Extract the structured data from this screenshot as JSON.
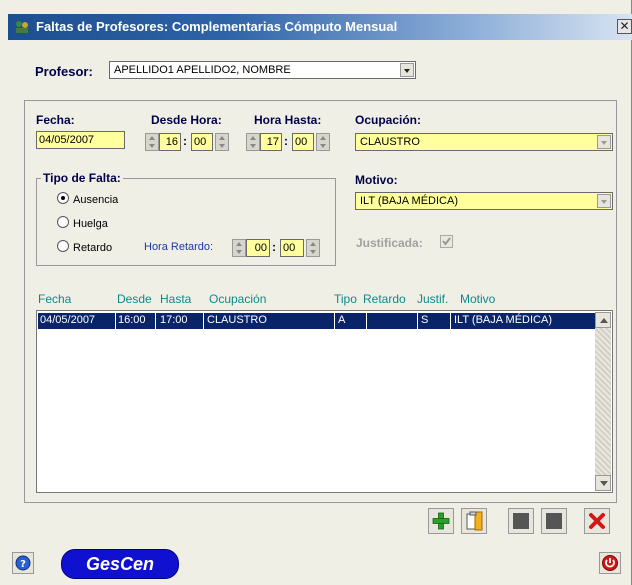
{
  "window": {
    "title": "Faltas de Profesores: Complementarias Cómputo Mensual",
    "close_icon": "close-icon"
  },
  "profesor": {
    "label": "Profesor:",
    "value": "APELLIDO1 APELLIDO2, NOMBRE"
  },
  "fecha": {
    "label": "Fecha:",
    "value": "04/05/2007"
  },
  "desde_hora": {
    "label": "Desde Hora:",
    "hour": "16",
    "minute": "00",
    "sep": ":"
  },
  "hora_hasta": {
    "label": "Hora Hasta:",
    "hour": "17",
    "minute": "00",
    "sep": ":"
  },
  "ocupacion": {
    "label": "Ocupación:",
    "value": "CLAUSTRO"
  },
  "tipo_falta": {
    "label": "Tipo de Falta:",
    "options": [
      {
        "label": "Ausencia",
        "selected": true
      },
      {
        "label": "Huelga",
        "selected": false
      },
      {
        "label": "Retardo",
        "selected": false
      }
    ],
    "hora_retardo": {
      "label": "Hora Retardo:",
      "hour": "00",
      "minute": "00",
      "sep": ":"
    }
  },
  "motivo": {
    "label": "Motivo:",
    "value": "ILT (BAJA MÉDICA)"
  },
  "justificada": {
    "label": "Justificada:",
    "checked": true
  },
  "table": {
    "headers": [
      "Fecha",
      "Desde",
      "Hasta",
      "Ocupación",
      "Tipo",
      "Retardo",
      "Justif.",
      "Motivo"
    ],
    "rows": [
      {
        "fecha": "04/05/2007",
        "desde": "16:00",
        "hasta": "17:00",
        "ocupacion": "CLAUSTRO",
        "tipo": "A",
        "retardo": "",
        "justif": "S",
        "motivo": "ILT (BAJA MÉDICA)",
        "selected": true
      }
    ]
  },
  "toolbar": [
    "add-icon",
    "clipboard-icon",
    "blank-button",
    "blank-button",
    "delete-icon"
  ],
  "footer": {
    "logo": "GesCen",
    "help_icon": "help-icon",
    "power_icon": "power-icon"
  },
  "colors": {
    "title_bar": "#1c4f8f",
    "label": "#00004a",
    "header": "#0a8a8a",
    "field_yellow": "#ffff9d",
    "selection": "#0a246a",
    "logo": "#1010d0"
  }
}
